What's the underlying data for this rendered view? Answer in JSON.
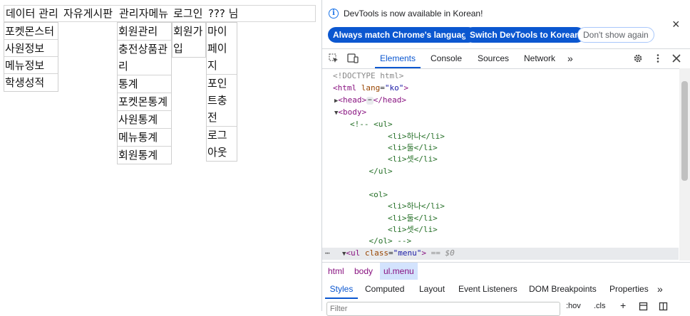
{
  "menu": {
    "top": [
      "데이터 관리",
      "자유게시판",
      "관리자메뉴",
      "로그인",
      "??? 님"
    ],
    "data_sub": [
      "포켓몬스터",
      "사원정보",
      "메뉴정보",
      "학생성적"
    ],
    "admin_sub": [
      "회원관리",
      "충전상품관리",
      "통계",
      "포켓몬통계",
      "사원통계",
      "메뉴통계",
      "회원통계"
    ],
    "login_sub": [
      "회원가입"
    ],
    "user_sub": [
      "마이페이지",
      "포인트충전",
      "로그아웃"
    ]
  },
  "devtools": {
    "banner": {
      "message": "DevTools is now available in Korean!",
      "btn_match": "Always match Chrome's language",
      "btn_switch": "Switch DevTools to Korean",
      "btn_dismiss": "Don't show again",
      "close": "×"
    },
    "tabs": [
      "Elements",
      "Console",
      "Sources",
      "Network"
    ],
    "more_tabs": "»",
    "code": {
      "doctype": "<!DOCTYPE html>",
      "html_open": "<html",
      "lang_attr": "lang",
      "lang_val": "\"ko\"",
      "head_open": "<head>",
      "head_close": "</head>",
      "ellipsis": "⋯",
      "body": "<body>",
      "comment": [
        "<!-- <ul>",
        "        <li>하나</li>",
        "        <li>둘</li>",
        "        <li>셋</li>",
        "    </ul>",
        "",
        "    <ol>",
        "        <li>하나</li>",
        "        <li>둘</li>",
        "        <li>셋</li>",
        "    </ol> -->"
      ],
      "sel_tag": "<ul",
      "sel_attr": "class",
      "sel_val": "\"menu\"",
      "sel_end": ">",
      "sel_eq": "== $0",
      "dots": "⋯"
    },
    "breadcrumbs": [
      "html",
      "body",
      "ul.menu"
    ],
    "subtabs": [
      "Styles",
      "Computed",
      "Layout",
      "Event Listeners",
      "DOM Breakpoints",
      "Properties"
    ],
    "filter_placeholder": "Filter",
    "hov": ":hov",
    "cls": ".cls",
    "plus": "+"
  }
}
